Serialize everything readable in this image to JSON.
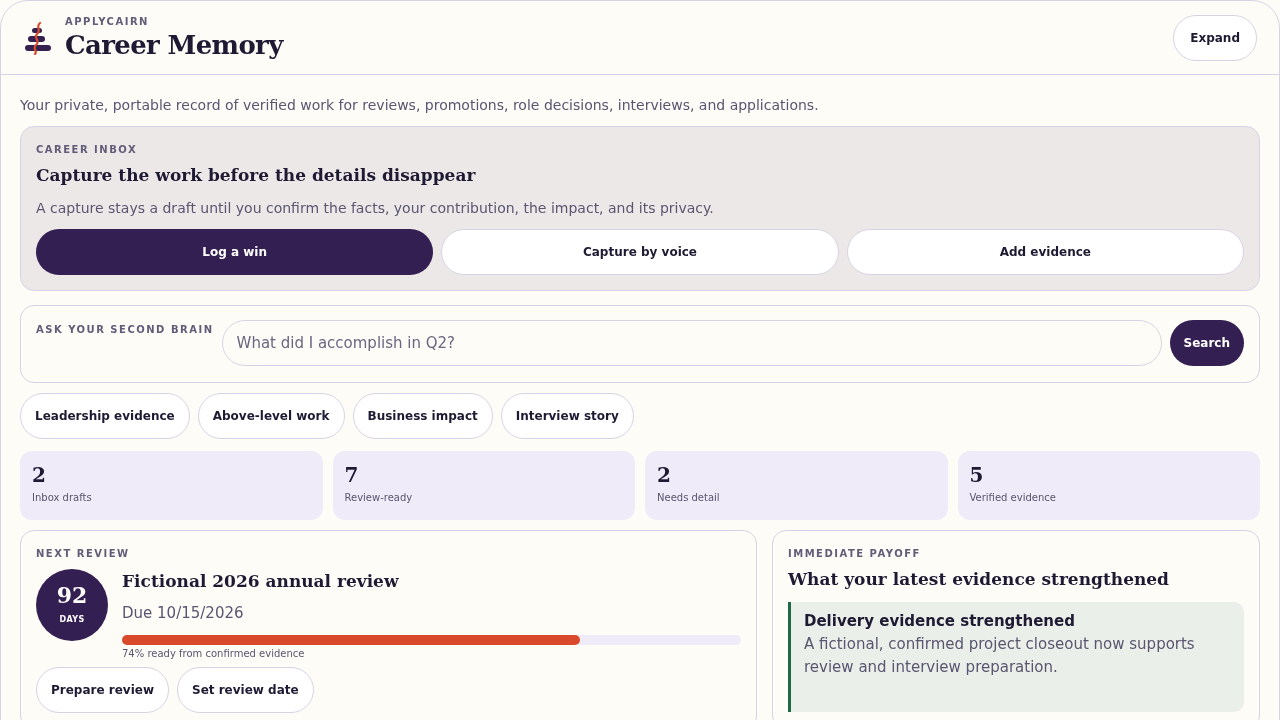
{
  "header": {
    "brand": "APPLYCAIRN",
    "title": "Career Memory",
    "expand_button": "Expand"
  },
  "intro": "Your private, portable record of verified work for reviews, promotions, role decisions, interviews, and applications.",
  "inbox": {
    "eyebrow": "CAREER INBOX",
    "title": "Capture the work before the details disappear",
    "description": "A capture stays a draft until you confirm the facts, your contribution, the impact, and its privacy.",
    "buttons": [
      {
        "label": "Log a win",
        "primary": true
      },
      {
        "label": "Capture by voice",
        "primary": false
      },
      {
        "label": "Add evidence",
        "primary": false
      }
    ]
  },
  "ask": {
    "eyebrow": "ASK YOUR SECOND BRAIN",
    "placeholder": "What did I accomplish in Q2?",
    "button": "Search"
  },
  "chips": [
    "Leadership evidence",
    "Above-level work",
    "Business impact",
    "Interview story"
  ],
  "stats": [
    {
      "value": "2",
      "label": "Inbox drafts"
    },
    {
      "value": "7",
      "label": "Review-ready"
    },
    {
      "value": "2",
      "label": "Needs detail"
    },
    {
      "value": "5",
      "label": "Verified evidence"
    }
  ],
  "next_review": {
    "eyebrow": "NEXT REVIEW",
    "days": "92",
    "days_label": "DAYS",
    "title": "Fictional 2026 annual review",
    "due": "Due 10/15/2026",
    "level": 0.74,
    "progress_label": "74% ready from confirmed evidence",
    "buttons": [
      "Prepare review",
      "Set review date"
    ]
  },
  "payoff": {
    "eyebrow": "IMMEDIATE PAYOFF",
    "title": "What your latest evidence strengthened",
    "callout": {
      "title": "Delivery evidence strengthened",
      "text": "A fictional, confirmed project closeout now supports review and interview preparation."
    }
  }
}
